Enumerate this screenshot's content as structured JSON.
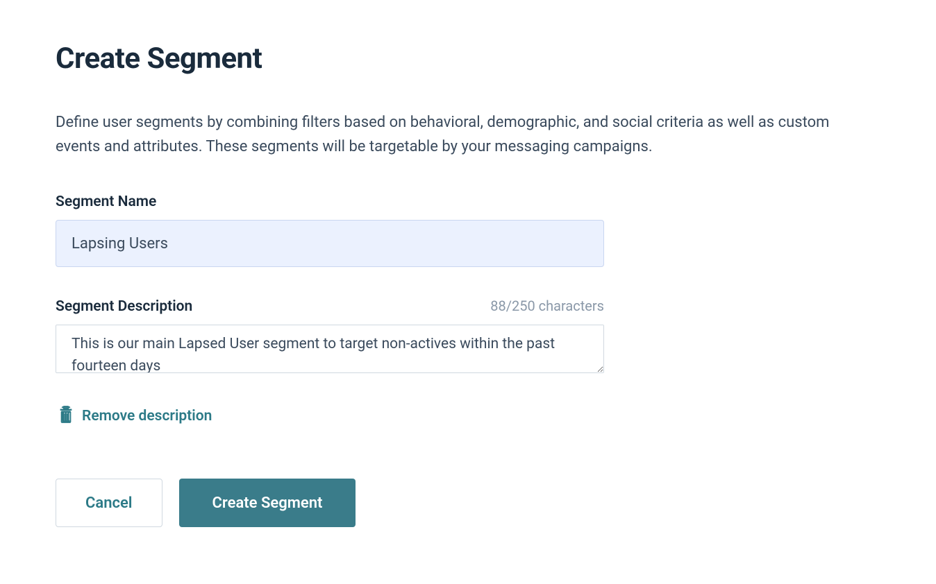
{
  "header": {
    "title": "Create Segment"
  },
  "intro": {
    "text": "Define user segments by combining filters based on behavioral, demographic, and social criteria as well as custom events and attributes. These segments will be targetable by your messaging campaigns."
  },
  "form": {
    "name_label": "Segment Name",
    "name_value": "Lapsing Users",
    "description_label": "Segment Description",
    "description_value": "This is our main Lapsed User segment to target non-actives within the past fourteen days",
    "char_count": "88/250 characters",
    "remove_description_label": "Remove description"
  },
  "buttons": {
    "cancel": "Cancel",
    "create": "Create Segment"
  }
}
